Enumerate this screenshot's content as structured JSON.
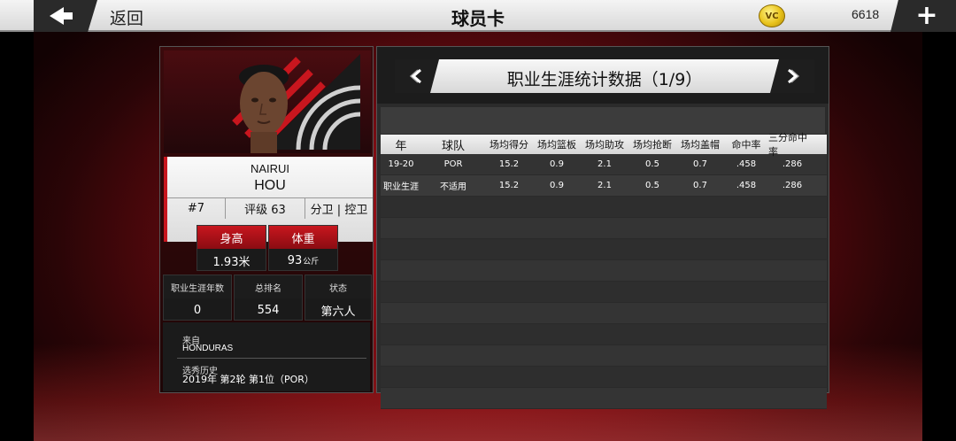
{
  "topbar": {
    "back_label": "返回",
    "title": "球员卡",
    "currency_icon": "vc-coin-icon",
    "currency_icon_text": "VC",
    "currency_amount": "6618",
    "add_label": "+"
  },
  "player": {
    "first_name": "NAIRUI",
    "last_name": "HOU",
    "number": "#7",
    "rating": "评级 63",
    "position": "分卫 | 控卫",
    "height_label": "身高",
    "height_value": "1.93米",
    "weight_label": "体重",
    "weight_value": "93",
    "weight_unit": "公斤",
    "career_years_label": "职业生涯年数",
    "career_years_value": "0",
    "overall_rank_label": "总排名",
    "overall_rank_value": "554",
    "status_label": "状态",
    "status_value": "第六人",
    "origin_label": "来自",
    "origin_value": "HONDURAS",
    "draft_label": "选秀历史",
    "draft_value": "2019年 第2轮 第1位（POR）"
  },
  "stats": {
    "title": "职业生涯统计数据（1/9）",
    "columns": [
      "年",
      "球队",
      "场均得分",
      "场均篮板",
      "场均助攻",
      "场均抢断",
      "场均盖帽",
      "命中率",
      "三分命中率"
    ],
    "rows": [
      [
        "19-20",
        "POR",
        "15.2",
        "0.9",
        "2.1",
        "0.5",
        "0.7",
        ".458",
        ".286"
      ],
      [
        "职业生涯",
        "不适用",
        "15.2",
        "0.9",
        "2.1",
        "0.5",
        "0.7",
        ".458",
        ".286"
      ]
    ]
  },
  "colors": {
    "accent_red": "#c8161e",
    "header_light": "#f2f2f2",
    "panel_dark": "#2b2b2b"
  }
}
